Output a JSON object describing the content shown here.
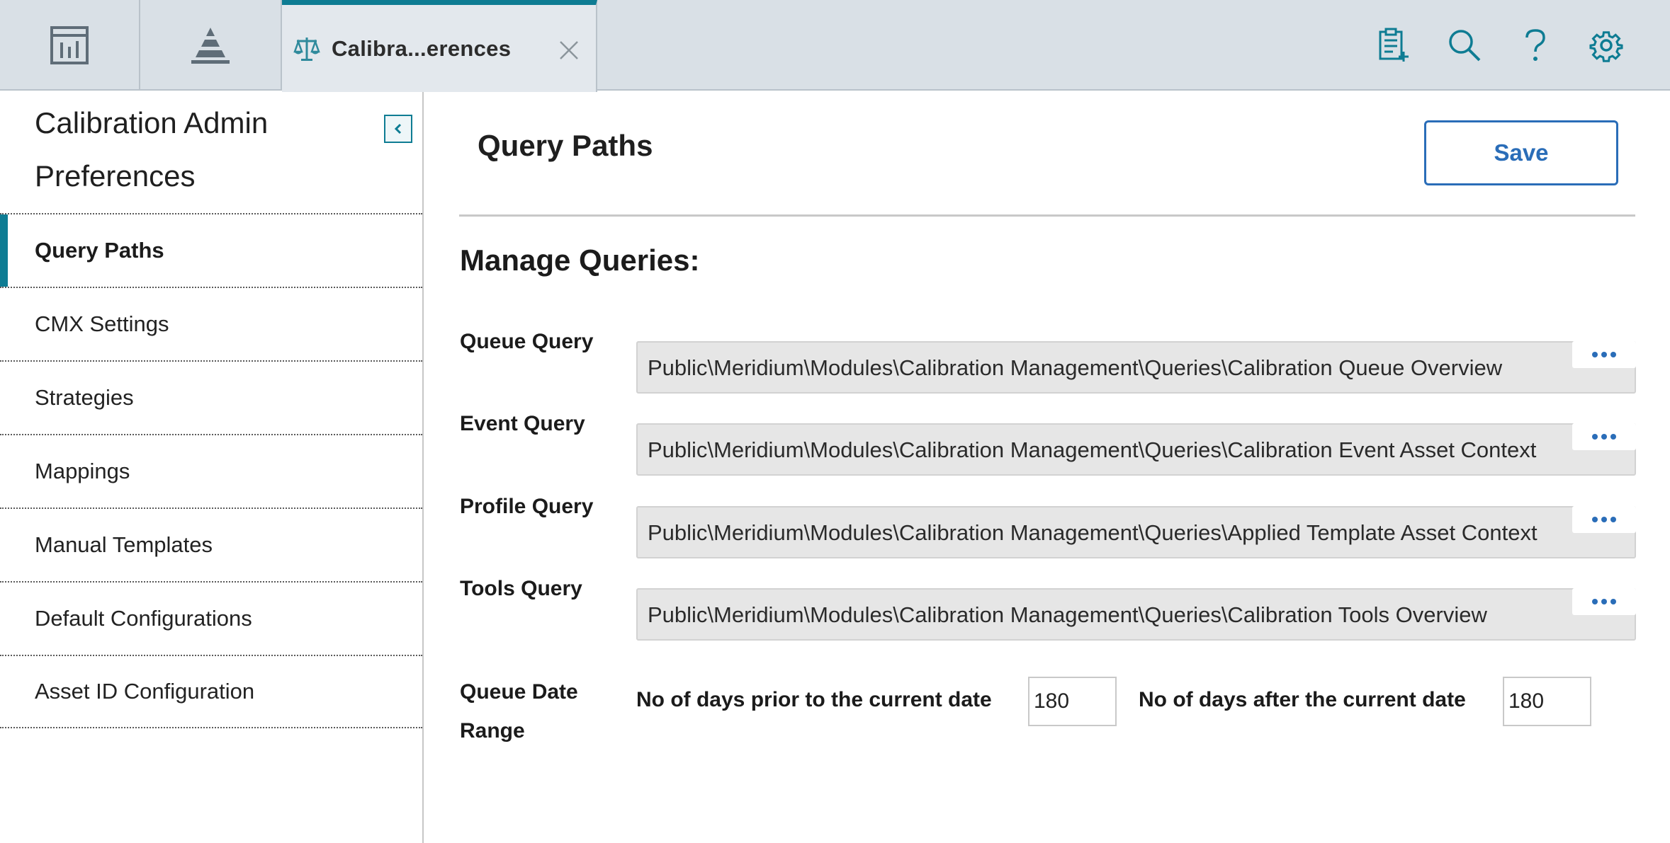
{
  "tabs": {
    "active_title": "Calibra...erences",
    "app_tab_icons": [
      "dashboard-icon",
      "pyramid-icon"
    ],
    "active_tab_icon": "scales-icon"
  },
  "toolbar_icons": [
    "clipboard-add-icon",
    "search-icon",
    "help-icon",
    "gear-icon"
  ],
  "sidebar": {
    "title": "Calibration Admin Preferences",
    "items": [
      {
        "label": "Query Paths",
        "active": true
      },
      {
        "label": "CMX Settings",
        "active": false
      },
      {
        "label": "Strategies",
        "active": false
      },
      {
        "label": "Mappings",
        "active": false
      },
      {
        "label": "Manual Templates",
        "active": false
      },
      {
        "label": "Default Configurations",
        "active": false
      },
      {
        "label": "Asset ID Configuration",
        "active": false
      }
    ]
  },
  "main": {
    "title": "Query Paths",
    "save_label": "Save",
    "section_title": "Manage Queries:",
    "queries": [
      {
        "label": "Queue Query",
        "value": "Public\\Meridium\\Modules\\Calibration Management\\Queries\\Calibration Queue Overview"
      },
      {
        "label": "Event Query",
        "value": "Public\\Meridium\\Modules\\Calibration Management\\Queries\\Calibration Event Asset Context"
      },
      {
        "label": "Profile Query",
        "value": "Public\\Meridium\\Modules\\Calibration Management\\Queries\\Applied Template Asset Context"
      },
      {
        "label": "Tools Query",
        "value": "Public\\Meridium\\Modules\\Calibration Management\\Queries\\Calibration Tools Overview"
      }
    ],
    "queue_date_range": {
      "label": "Queue Date Range",
      "prior_label": "No of days prior to the current date",
      "prior_value": "180",
      "after_label": "No of days after the current date",
      "after_value": "180"
    }
  },
  "colors": {
    "accent": "#0e7c93",
    "link_blue": "#2a6db8",
    "topbar_bg": "#d9e0e6"
  }
}
